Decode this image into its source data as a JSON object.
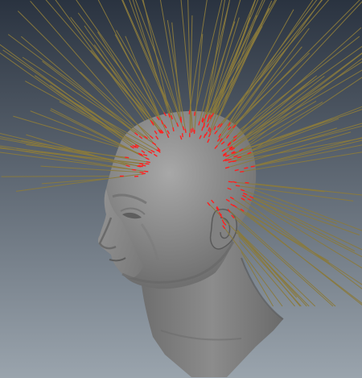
{
  "viewport": {
    "gradient_top": "#2a3340",
    "gradient_bottom": "#9aa4ad"
  },
  "head": {
    "skin_color": "#8f8f8f",
    "shadow_color": "#555555",
    "highlight_color": "#b4b4b4"
  },
  "hair_curves": {
    "stroke_color": "#8a7a3c",
    "root_color": "#ff2020"
  }
}
